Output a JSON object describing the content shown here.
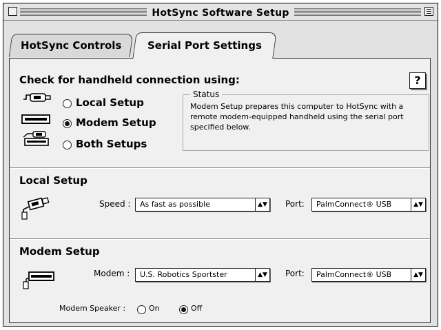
{
  "window": {
    "title": "HotSync Software Setup"
  },
  "tabs": [
    {
      "label": "HotSync Controls"
    },
    {
      "label": "Serial Port Settings"
    }
  ],
  "check": {
    "heading": "Check for handheld connection using:",
    "options": [
      {
        "label": "Local Setup",
        "selected": false
      },
      {
        "label": "Modem Setup",
        "selected": true
      },
      {
        "label": "Both Setups",
        "selected": false
      }
    ],
    "help_label": "?"
  },
  "status": {
    "title": "Status",
    "text": "Modem Setup prepares this computer to HotSync with a remote modem-equipped handheld using the serial port specified below."
  },
  "local": {
    "heading": "Local Setup",
    "speed_label": "Speed :",
    "speed_value": "As fast as possible",
    "port_label": "Port:",
    "port_value": "PalmConnect® USB"
  },
  "modem": {
    "heading": "Modem Setup",
    "modem_label": "Modem :",
    "modem_value": "U.S. Robotics Sportster",
    "port_label": "Port:",
    "port_value": "PalmConnect® USB",
    "speaker_label": "Modem Speaker :",
    "speaker_on": "On",
    "speaker_off": "Off",
    "speaker_selected": "Off"
  }
}
